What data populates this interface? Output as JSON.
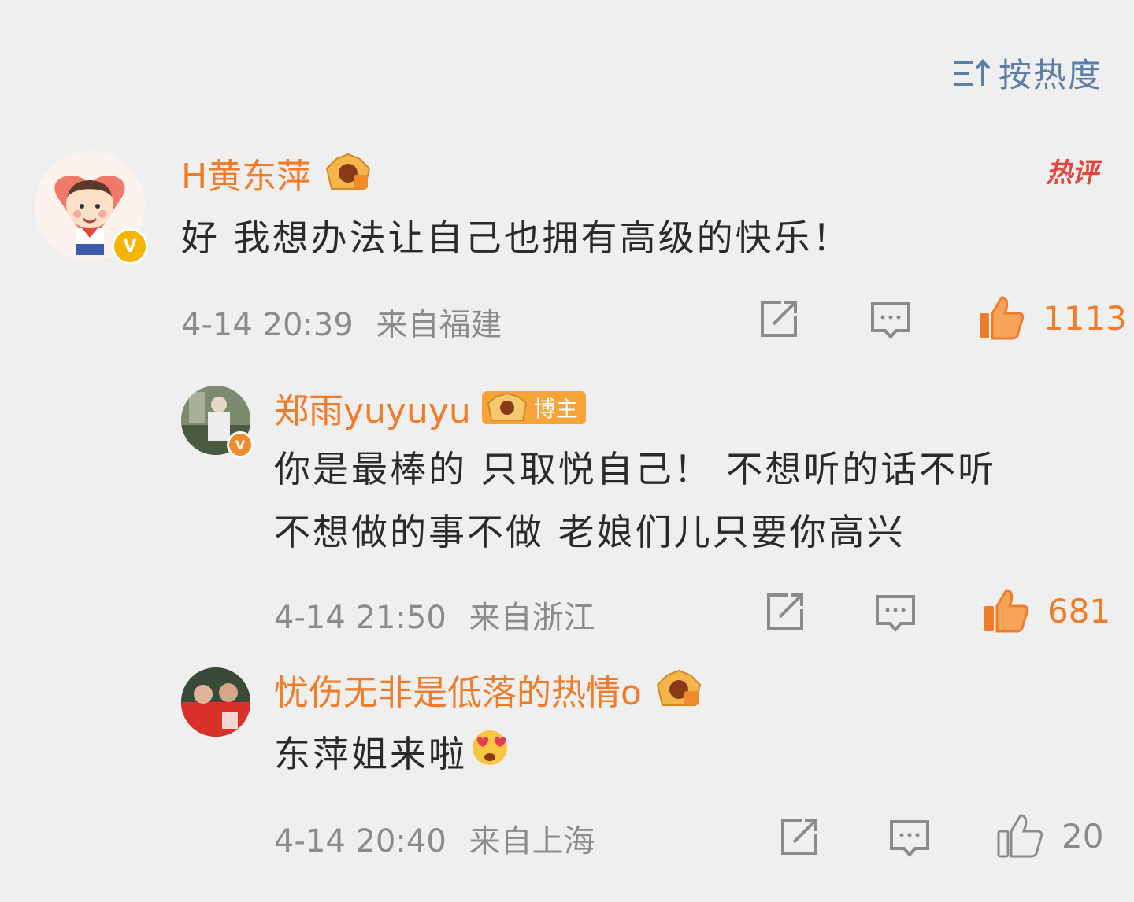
{
  "sort": {
    "label": "按热度",
    "icon": "sort-up-icon"
  },
  "comments": [
    {
      "username": "H黄东萍",
      "hot_tag": "热评",
      "text": "好 我想办法让自己也拥有高级的快乐！",
      "time": "4-14 20:39",
      "location": "来自福建",
      "likes": "1113",
      "liked": true
    },
    {
      "username": "郑雨yuyuyu",
      "role_badge": "博主",
      "text_lines": [
        "你是最棒的 只取悦自己！ 不想听的话不听",
        "不想做的事不做 老娘们儿只要你高兴"
      ],
      "time": "4-14 21:50",
      "location": "来自浙江",
      "likes": "681",
      "liked": true
    },
    {
      "username": "忧伤无非是低落的热情o",
      "text": "东萍姐来啦",
      "emoji": "heart-eyes-emoji",
      "time": "4-14 20:40",
      "location": "来自上海",
      "likes": "20",
      "liked": false
    }
  ],
  "colors": {
    "background": "#efefef",
    "username": "#f07c2a",
    "link_blue": "#5a7fa6",
    "meta_gray": "#8b8b8b",
    "hot_red": "#e2463c"
  }
}
